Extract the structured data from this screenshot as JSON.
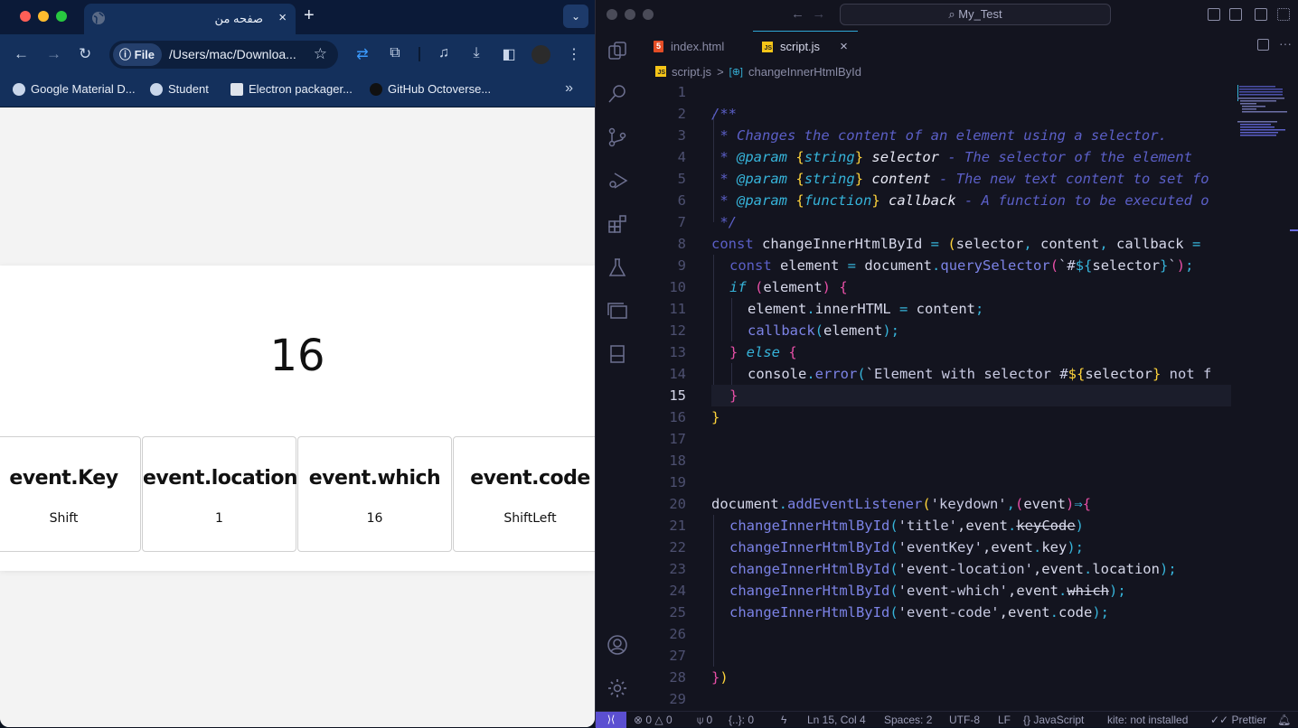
{
  "browser": {
    "tab_title": "صفحه من",
    "tab_close": "×",
    "new_tab": "+",
    "tab_search": "⌄",
    "omnibox": {
      "chip_label": "File",
      "url": "/Users/mac/Downloa..."
    },
    "bookmarks": [
      {
        "label": "Google Material D...",
        "icon": "globe-icon"
      },
      {
        "label": "Student",
        "icon": "globe-icon"
      },
      {
        "label": "Electron packager...",
        "icon": "page-icon"
      },
      {
        "label": "GitHub Octoverse...",
        "icon": "github-icon"
      }
    ],
    "bookmarks_more": "»",
    "page": {
      "title": "16",
      "cards": [
        {
          "heading": "event.Key",
          "value": "Shift"
        },
        {
          "heading": "event.location",
          "value": "1"
        },
        {
          "heading": "event.which",
          "value": "16"
        },
        {
          "heading": "event.code",
          "value": "ShiftLeft"
        }
      ]
    }
  },
  "vscode": {
    "search": "My_Test",
    "tabs": [
      {
        "label": "index.html",
        "icon": "html5-icon",
        "active": false
      },
      {
        "label": "script.js",
        "icon": "js-icon",
        "active": true,
        "close": "×"
      }
    ],
    "breadcrumb": {
      "file": "script.js",
      "separator": ">",
      "symbol": "changeInnerHtmlById"
    },
    "current_line": 15,
    "status": {
      "errors": "0",
      "warnings": "0",
      "ports": "0",
      "braces": "{..}: 0",
      "position": "Ln 15, Col 4",
      "spaces": "Spaces: 2",
      "encoding": "UTF-8",
      "eol": "LF",
      "language": "JavaScript",
      "kite": "kite: not installed",
      "prettier": "Prettier"
    },
    "lines": [
      "1",
      "2",
      "3",
      "4",
      "5",
      "6",
      "7",
      "8",
      "9",
      "10",
      "11",
      "12",
      "13",
      "14",
      "15",
      "16",
      "17",
      "18",
      "19",
      "20",
      "21",
      "22",
      "23",
      "24",
      "25",
      "26",
      "27",
      "28",
      "29"
    ],
    "code": {
      "l2": "/**",
      "l3": " * Changes the content of an element using a selector.",
      "l4a": " * ",
      "l4b": "@param",
      "l4c": "{",
      "l4d": "string",
      "l4e": "}",
      "l4f": " selector",
      "l4g": " - The selector of the element",
      "l5a": " * ",
      "l5b": "@param",
      "l5c": "{",
      "l5d": "string",
      "l5e": "}",
      "l5f": " content",
      "l5g": " - The new text content to set fo",
      "l6a": " * ",
      "l6b": "@param",
      "l6c": "{",
      "l6d": "function",
      "l6e": "}",
      "l6f": " callback",
      "l6g": " - A function to be executed o",
      "l7": " */",
      "l8a": "const",
      "l8b": " changeInnerHtmlById ",
      "l8c": "=",
      "l8d": " (",
      "l8e": "selector",
      "l8f": ",",
      "l8g": " content",
      "l8h": ",",
      "l8i": " callback ",
      "l8j": "=",
      "l9a": "const",
      "l9b": " element ",
      "l9c": "=",
      "l9d": " document",
      "l9e": ".",
      "l9f": "querySelector",
      "l9g": "(",
      "l9h": "`#",
      "l9i": "${",
      "l9j": "selector",
      "l9k": "}",
      "l9l": "`",
      "l9m": ")",
      "l9n": ";",
      "l10a": "if",
      "l10b": " (",
      "l10c": "element",
      "l10d": ")",
      "l10e": " {",
      "l11a": "element",
      "l11b": ".",
      "l11c": "innerHTML ",
      "l11d": "=",
      "l11e": " content",
      "l11f": ";",
      "l12a": "callback",
      "l12b": "(",
      "l12c": "element",
      "l12d": ")",
      "l12e": ";",
      "l13a": "}",
      "l13b": " else",
      "l13c": " {",
      "l14a": "console",
      "l14b": ".",
      "l14c": "error",
      "l14d": "(",
      "l14e": "`Element with selector #",
      "l14f": "$",
      "l14g": "{",
      "l14h": "selector",
      "l14i": "}",
      "l14j": " not f",
      "l15": "}",
      "l16": "}",
      "l20a": "document",
      "l20b": ".",
      "l20c": "addEventListener",
      "l20d": "(",
      "l20e": "'keydown'",
      "l20f": ",",
      "l20g": "(",
      "l20h": "event",
      "l20i": ")",
      "l20j": "⇒",
      "l20k": "{",
      "l21a": "changeInnerHtmlById",
      "l21b": "(",
      "l21c": "'title'",
      "l21d": ",event",
      "l21e": ".",
      "l21f": "keyCode",
      "l21g": ")",
      "l22a": "changeInnerHtmlById",
      "l22b": "(",
      "l22c": "'eventKey'",
      "l22d": ",event",
      "l22e": ".",
      "l22f": "key",
      "l22g": ")",
      "l22h": ";",
      "l23a": "changeInnerHtmlById",
      "l23b": "(",
      "l23c": "'event-location'",
      "l23d": ",event",
      "l23e": ".",
      "l23f": "location",
      "l23g": ")",
      "l23h": ";",
      "l24a": "changeInnerHtmlById",
      "l24b": "(",
      "l24c": "'event-which'",
      "l24d": ",event",
      "l24e": ".",
      "l24f": "which",
      "l24g": ")",
      "l24h": ";",
      "l25a": "changeInnerHtmlById",
      "l25b": "(",
      "l25c": "'event-code'",
      "l25d": ",event",
      "l25e": ".",
      "l25f": "code",
      "l25g": ")",
      "l25h": ";",
      "l28a": "}",
      "l28b": ")"
    }
  }
}
